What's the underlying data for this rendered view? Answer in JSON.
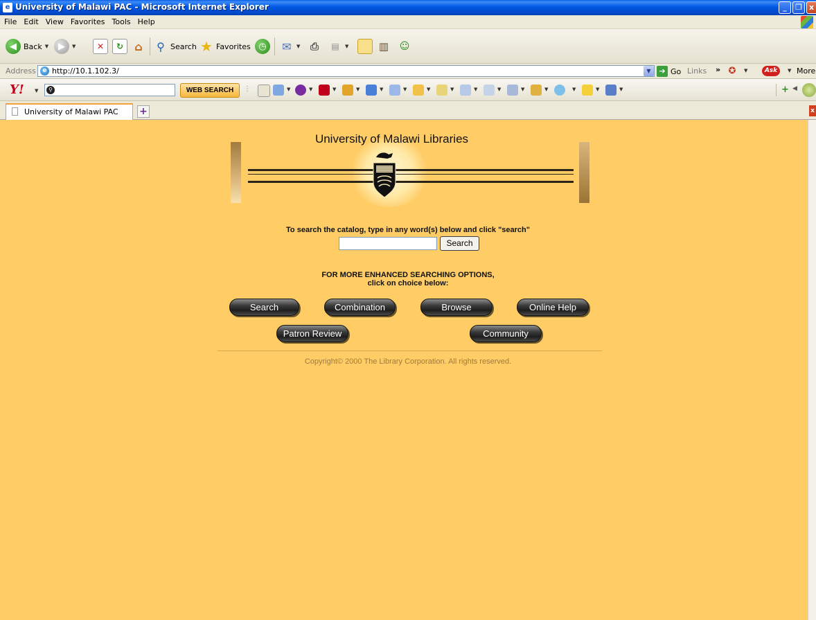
{
  "window": {
    "title": "University of Malawi PAC - Microsoft Internet Explorer",
    "minimize": "_",
    "restore": "❐",
    "close": "x"
  },
  "menu": [
    "File",
    "Edit",
    "View",
    "Favorites",
    "Tools",
    "Help"
  ],
  "toolbar": {
    "back": "Back",
    "search": "Search",
    "favorites": "Favorites"
  },
  "address": {
    "label": "Address",
    "url": "http://10.1.102.3/",
    "go": "Go",
    "links": "Links",
    "more": "More"
  },
  "yahoo": {
    "search_value": "",
    "web_search": "WEB SEARCH"
  },
  "tab": {
    "label": "University of Malawi PAC"
  },
  "page": {
    "banner_title": "University of Malawi Libraries",
    "search_prompt": "To search the catalog, type in any word(s) below and click \"search\"",
    "search_value": "",
    "search_button": "Search",
    "enhanced_line1": "FOR MORE ENHANCED SEARCHING OPTIONS,",
    "enhanced_line2": "click on choice below:",
    "buttons": {
      "search": "Search",
      "combination": "Combination",
      "browse": "Browse",
      "online_help": "Online Help",
      "patron_review": "Patron Review",
      "community": "Community"
    },
    "copyright": "Copyright© 2000 The Library Corporation. All rights reserved."
  },
  "colors": {
    "page_background": "#FFCC66",
    "titlebar_blue": "#0058E3",
    "copyright_text": "#A07A3A"
  },
  "icons": [
    "back-icon",
    "forward-icon",
    "stop-icon",
    "refresh-icon",
    "home-icon",
    "search-icon",
    "favorites-star-icon",
    "history-icon",
    "mail-icon",
    "print-icon",
    "edit-icon",
    "discuss-icon",
    "research-icon",
    "messenger-icon",
    "ie-page-icon",
    "go-arrow-icon",
    "yahoo-logo-icon",
    "ask-logo-icon",
    "new-tab-icon",
    "university-crest-icon"
  ]
}
